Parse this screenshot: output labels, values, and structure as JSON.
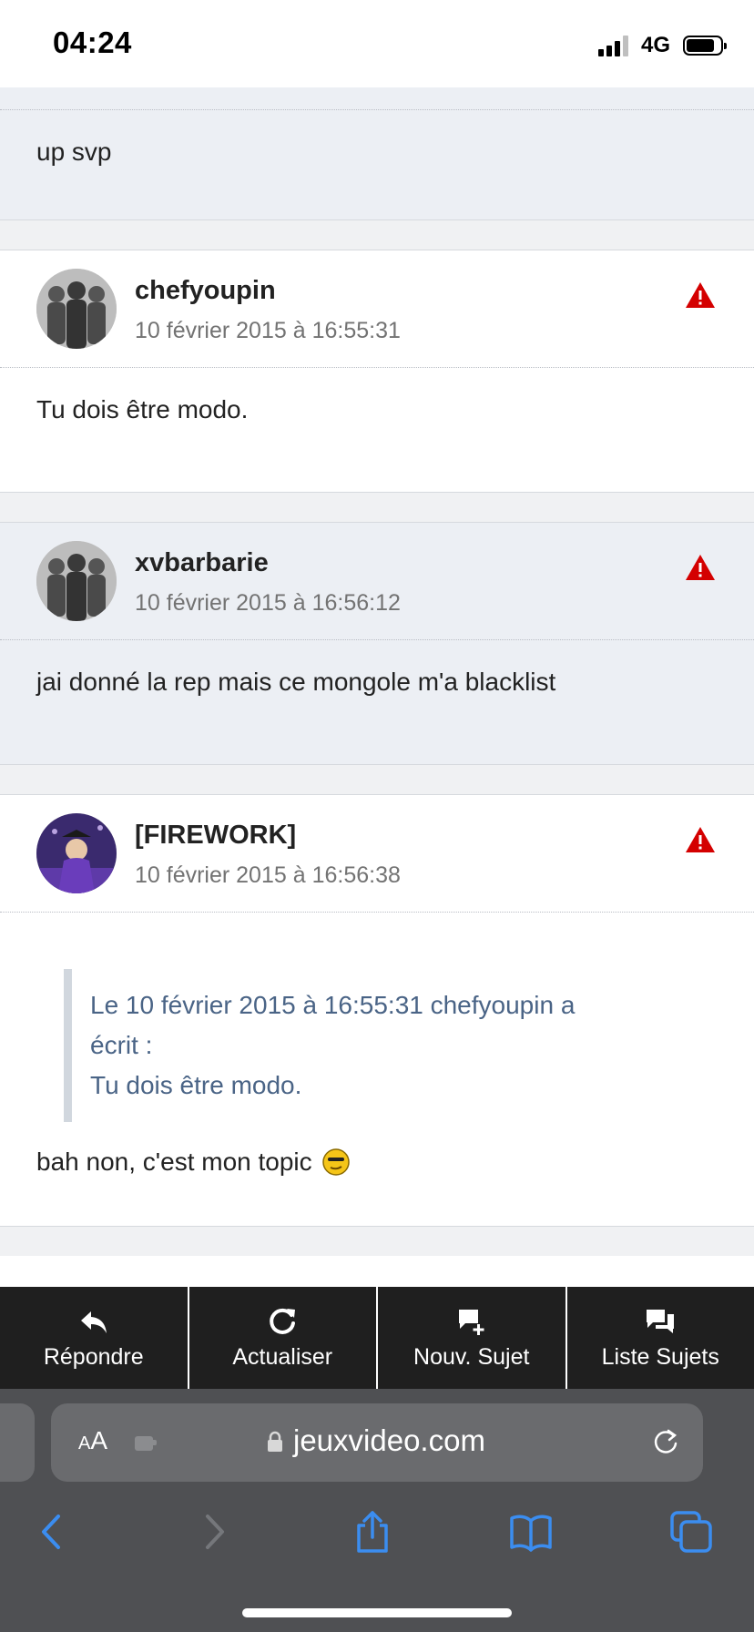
{
  "status_bar": {
    "time": "04:24",
    "network": "4G"
  },
  "posts": [
    {
      "author": "",
      "date": "",
      "body": "up svp",
      "style": "alt",
      "partial": true
    },
    {
      "author": "chefyoupin",
      "date": "10 février 2015 à 16:55:31",
      "body": "Tu dois être modo.",
      "style": "plain"
    },
    {
      "author": "xvbarbarie",
      "date": "10 février 2015 à 16:56:12",
      "body": "jai donné la rep mais ce mongole m'a blacklist",
      "style": "alt"
    },
    {
      "author": "[FIREWORK]",
      "date": "10 février 2015 à 16:56:38",
      "quote": {
        "line1": "Le 10 février 2015 à 16:55:31 chefyoupin a",
        "line2": "écrit :",
        "line3": "Tu dois être modo."
      },
      "body": "bah non, c'est mon topic",
      "style": "plain"
    }
  ],
  "actions": [
    {
      "label": "Répondre",
      "icon": "reply-icon"
    },
    {
      "label": "Actualiser",
      "icon": "refresh-icon"
    },
    {
      "label": "Nouv. Sujet",
      "icon": "new-topic-icon"
    },
    {
      "label": "Liste Sujets",
      "icon": "topic-list-icon"
    }
  ],
  "browser": {
    "aa_label": "AA",
    "url": "jeuxvideo.com"
  },
  "colors": {
    "accent_blue": "#3b8df0",
    "warning_red": "#d40000",
    "quote_text": "#4a6486"
  }
}
